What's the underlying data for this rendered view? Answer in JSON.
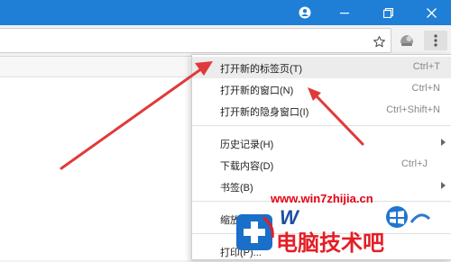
{
  "window": {
    "controls": [
      "account",
      "minimize",
      "restore",
      "close"
    ]
  },
  "toolbar": {
    "icons": [
      "star-icon",
      "extension-icon",
      "menu-dots-icon"
    ]
  },
  "menu": {
    "items": [
      {
        "label": "打开新的标签页(T)",
        "shortcut": "Ctrl+T"
      },
      {
        "label": "打开新的窗口(N)",
        "shortcut": "Ctrl+N"
      },
      {
        "label": "打开新的隐身窗口(I)",
        "shortcut": "Ctrl+Shift+N"
      },
      {
        "label": "历史记录(H)",
        "shortcut": ""
      },
      {
        "label": "下载内容(D)",
        "shortcut": "Ctrl+J"
      },
      {
        "label": "书签(B)",
        "shortcut": ""
      },
      {
        "label": "缩放",
        "shortcut": ""
      },
      {
        "label": "打印(P)...",
        "shortcut": ""
      }
    ]
  },
  "watermark": {
    "url": "www.win7zhijia.cn",
    "brand": "电脑技术吧"
  },
  "colors": {
    "titlebar": "#1f7fd6",
    "arrow": "#e03a3a",
    "watermark_red": "#e60012"
  }
}
